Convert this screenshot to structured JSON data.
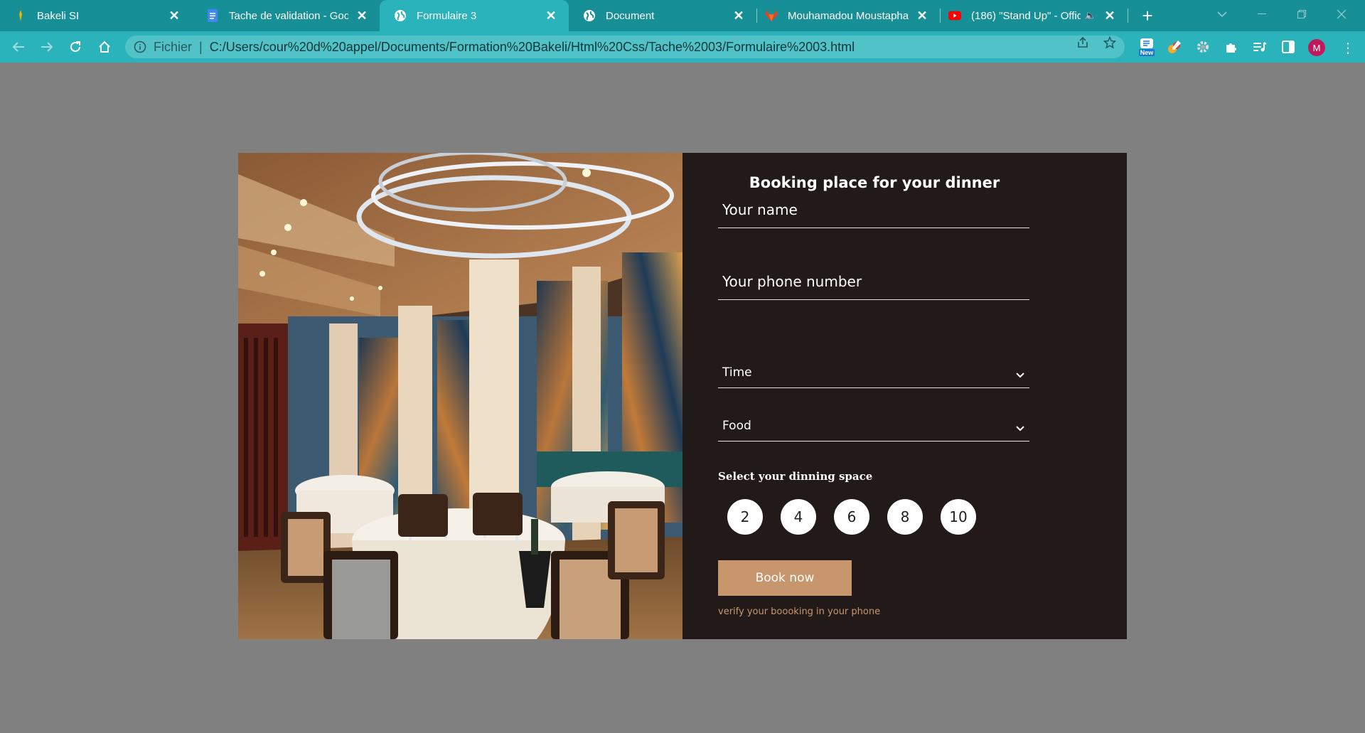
{
  "browser": {
    "tabs": [
      {
        "title": "Bakeli SI",
        "icon": "bakeli-favicon",
        "active": false
      },
      {
        "title": "Tache de validation - Googl",
        "icon": "google-docs-icon",
        "active": false
      },
      {
        "title": "Formulaire 3",
        "icon": "globe-icon",
        "active": true
      },
      {
        "title": "Document",
        "icon": "globe-icon",
        "active": false
      },
      {
        "title": "Mouhamadou Moustapha",
        "icon": "gitlab-icon",
        "active": false
      },
      {
        "title": "(186) \"Stand Up\" - Offic",
        "icon": "youtube-icon",
        "active": false
      }
    ],
    "new_tab_label": "+",
    "address": {
      "scheme_label": "Fichier",
      "url": "C:/Users/cour%20d%20appel/Documents/Formation%20Bakeli/Html%20Css/Tache%2003/Formulaire%2003.html"
    },
    "extensions": {
      "new_badge": "New"
    },
    "avatar_letter": "M",
    "colors": {
      "tabstrip": "#178f96",
      "active_tab": "#2ab3bb",
      "toolbar": "#2ab3bb",
      "omnibox": "#50c2c8",
      "avatar": "#c2185b"
    }
  },
  "page": {
    "background": "#808080",
    "form": {
      "title": "Booking place for your dinner",
      "name_placeholder": "Your name",
      "phone_placeholder": "Your phone number",
      "time_select": "Time",
      "food_select": "Food",
      "space_label": "Select your dinning space",
      "seats": [
        "2",
        "4",
        "6",
        "8",
        "10"
      ],
      "book_button": "Book now",
      "verify_note": "verify your boooking in your phone",
      "colors": {
        "panel": "#221a19",
        "accent": "#c8966c"
      }
    }
  }
}
